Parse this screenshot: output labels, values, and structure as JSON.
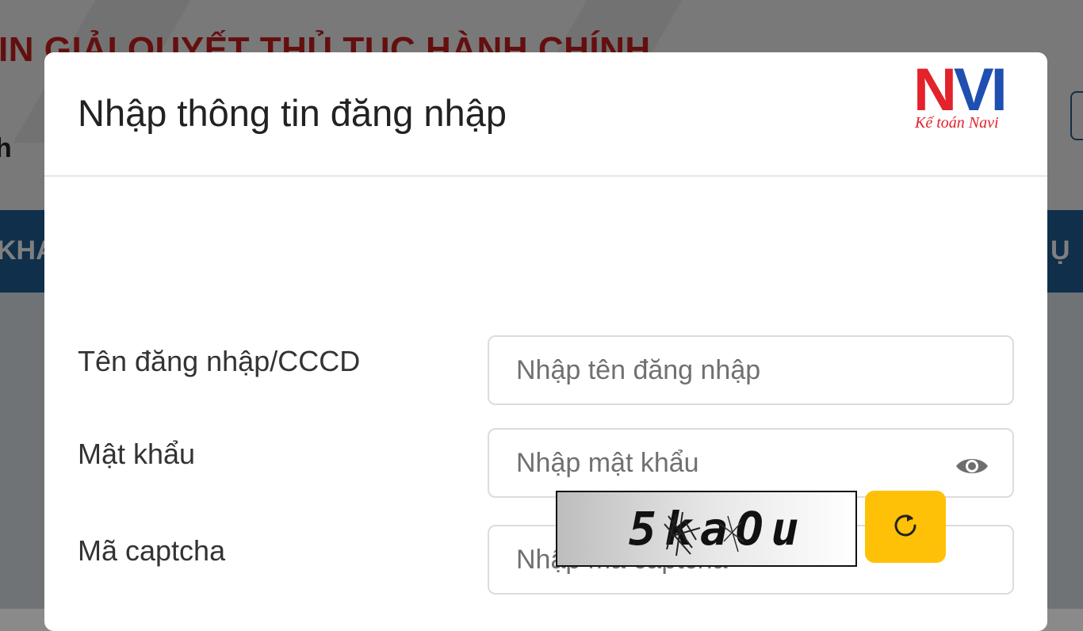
{
  "background": {
    "title": "IN GIẢI QUYẾT THỦ TỤC HÀNH CHÍNH",
    "sub_text": "h",
    "nav_left": "KHA",
    "nav_right": "Ụ"
  },
  "modal": {
    "title": "Nhập thông tin đăng nhập",
    "logo": {
      "letters_n": "N",
      "letters_vi": "VI",
      "tagline": "Kế toán Navi"
    },
    "fields": {
      "username": {
        "label": "Tên đăng nhập/CCCD",
        "placeholder": "Nhập tên đăng nhập",
        "value": ""
      },
      "password": {
        "label": "Mật khẩu",
        "placeholder": "Nhập mật khẩu",
        "value": "",
        "toggle_icon": "eye-icon"
      },
      "captcha": {
        "label": "Mã captcha",
        "placeholder": "Nhập mã captcha",
        "value": ""
      }
    },
    "captcha_image_text": "5kaOu",
    "refresh_icon": "refresh-icon"
  },
  "colors": {
    "title_red": "#c91f1f",
    "nav_blue": "#1f5f94",
    "refresh_yellow": "#ffc107",
    "logo_red": "#e3222b",
    "logo_blue": "#1f4fb0"
  }
}
